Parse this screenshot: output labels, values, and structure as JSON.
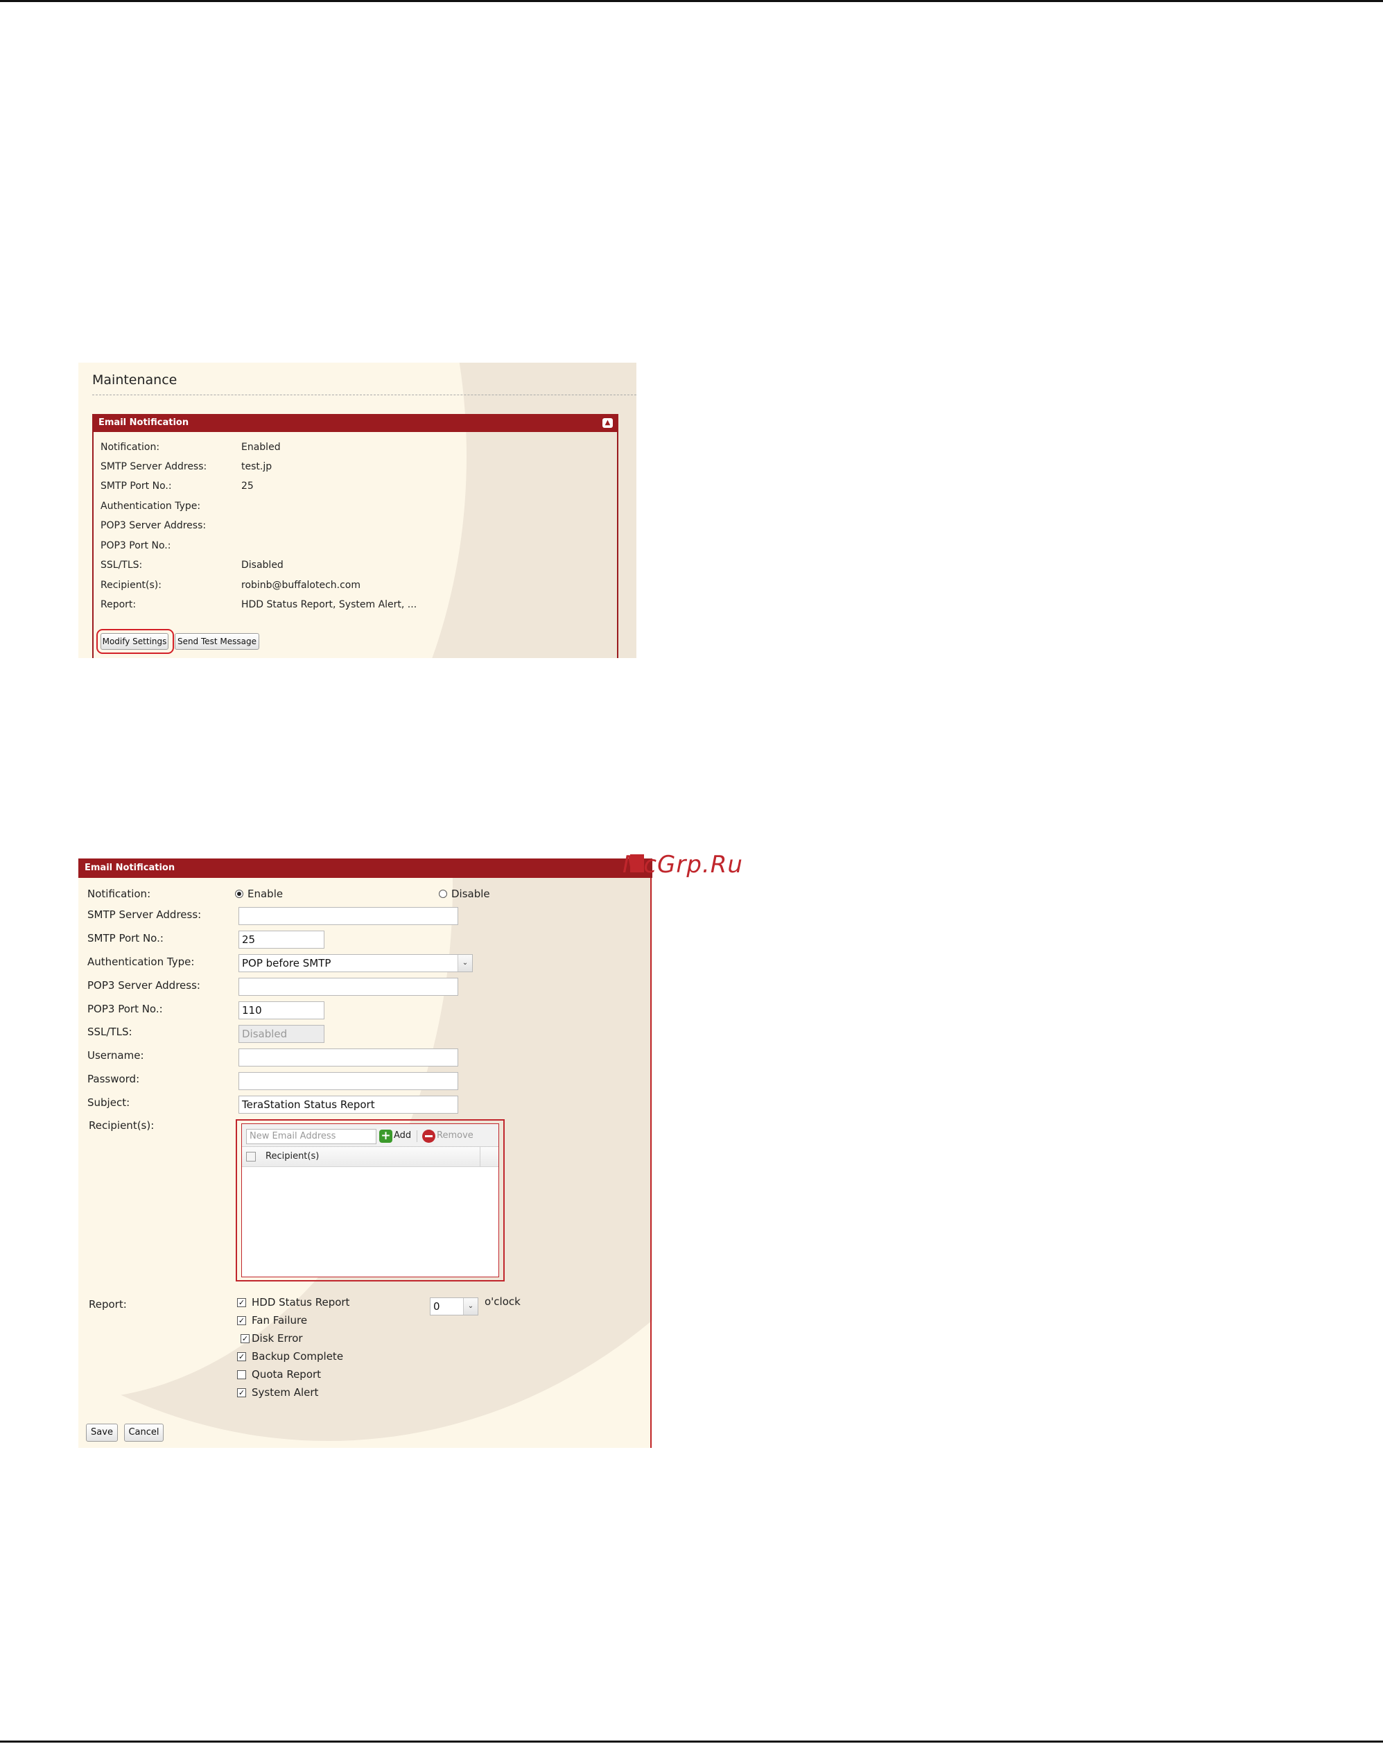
{
  "maintenance": {
    "title": "Maintenance",
    "panel_title": "Email Notification",
    "rows": [
      {
        "label": "Notification:",
        "value": "Enabled"
      },
      {
        "label": "SMTP Server Address:",
        "value": "test.jp"
      },
      {
        "label": "SMTP Port No.:",
        "value": "25"
      },
      {
        "label": "Authentication Type:",
        "value": ""
      },
      {
        "label": "POP3 Server Address:",
        "value": ""
      },
      {
        "label": "POP3 Port No.:",
        "value": ""
      },
      {
        "label": "SSL/TLS:",
        "value": "Disabled"
      },
      {
        "label": "Recipient(s):",
        "value": "robinb@buffalotech.com"
      },
      {
        "label": "Report:",
        "value": "HDD Status Report, System Alert, ..."
      }
    ],
    "modify_button": "Modify Settings",
    "test_button": "Send Test Message"
  },
  "edit": {
    "panel_title": "Email Notification",
    "notification_label": "Notification:",
    "enable_label": "Enable",
    "disable_label": "Disable",
    "notification_selected": "Enable",
    "smtp_server_label": "SMTP Server Address:",
    "smtp_server_value": "",
    "smtp_port_label": "SMTP Port No.:",
    "smtp_port_value": "25",
    "auth_type_label": "Authentication Type:",
    "auth_type_value": "POP before SMTP",
    "pop3_server_label": "POP3 Server Address:",
    "pop3_server_value": "",
    "pop3_port_label": "POP3 Port No.:",
    "pop3_port_value": "110",
    "ssl_label": "SSL/TLS:",
    "ssl_value": "Disabled",
    "username_label": "Username:",
    "username_value": "",
    "password_label": "Password:",
    "password_value": "",
    "subject_label": "Subject:",
    "subject_value": "TeraStation Status Report",
    "recipients_label": "Recipient(s):",
    "new_email_placeholder": "New Email Address",
    "add_label": "Add",
    "remove_label": "Remove",
    "recipients_column": "Recipient(s)",
    "report_label": "Report:",
    "report_items": [
      {
        "label": "HDD Status Report",
        "checked": true
      },
      {
        "label": "Fan Failure",
        "checked": true
      },
      {
        "label": "Disk Error",
        "checked": true
      },
      {
        "label": "Backup Complete",
        "checked": true
      },
      {
        "label": "Quota Report",
        "checked": false
      },
      {
        "label": "System Alert",
        "checked": true
      }
    ],
    "hour_value": "0",
    "oclock_label": "o'clock",
    "save_button": "Save",
    "cancel_button": "Cancel"
  },
  "watermark": "McGrp.Ru",
  "colors": {
    "accent": "#9b1b1f",
    "highlight": "#d32027",
    "panel_bg": "#fdf7e8"
  }
}
